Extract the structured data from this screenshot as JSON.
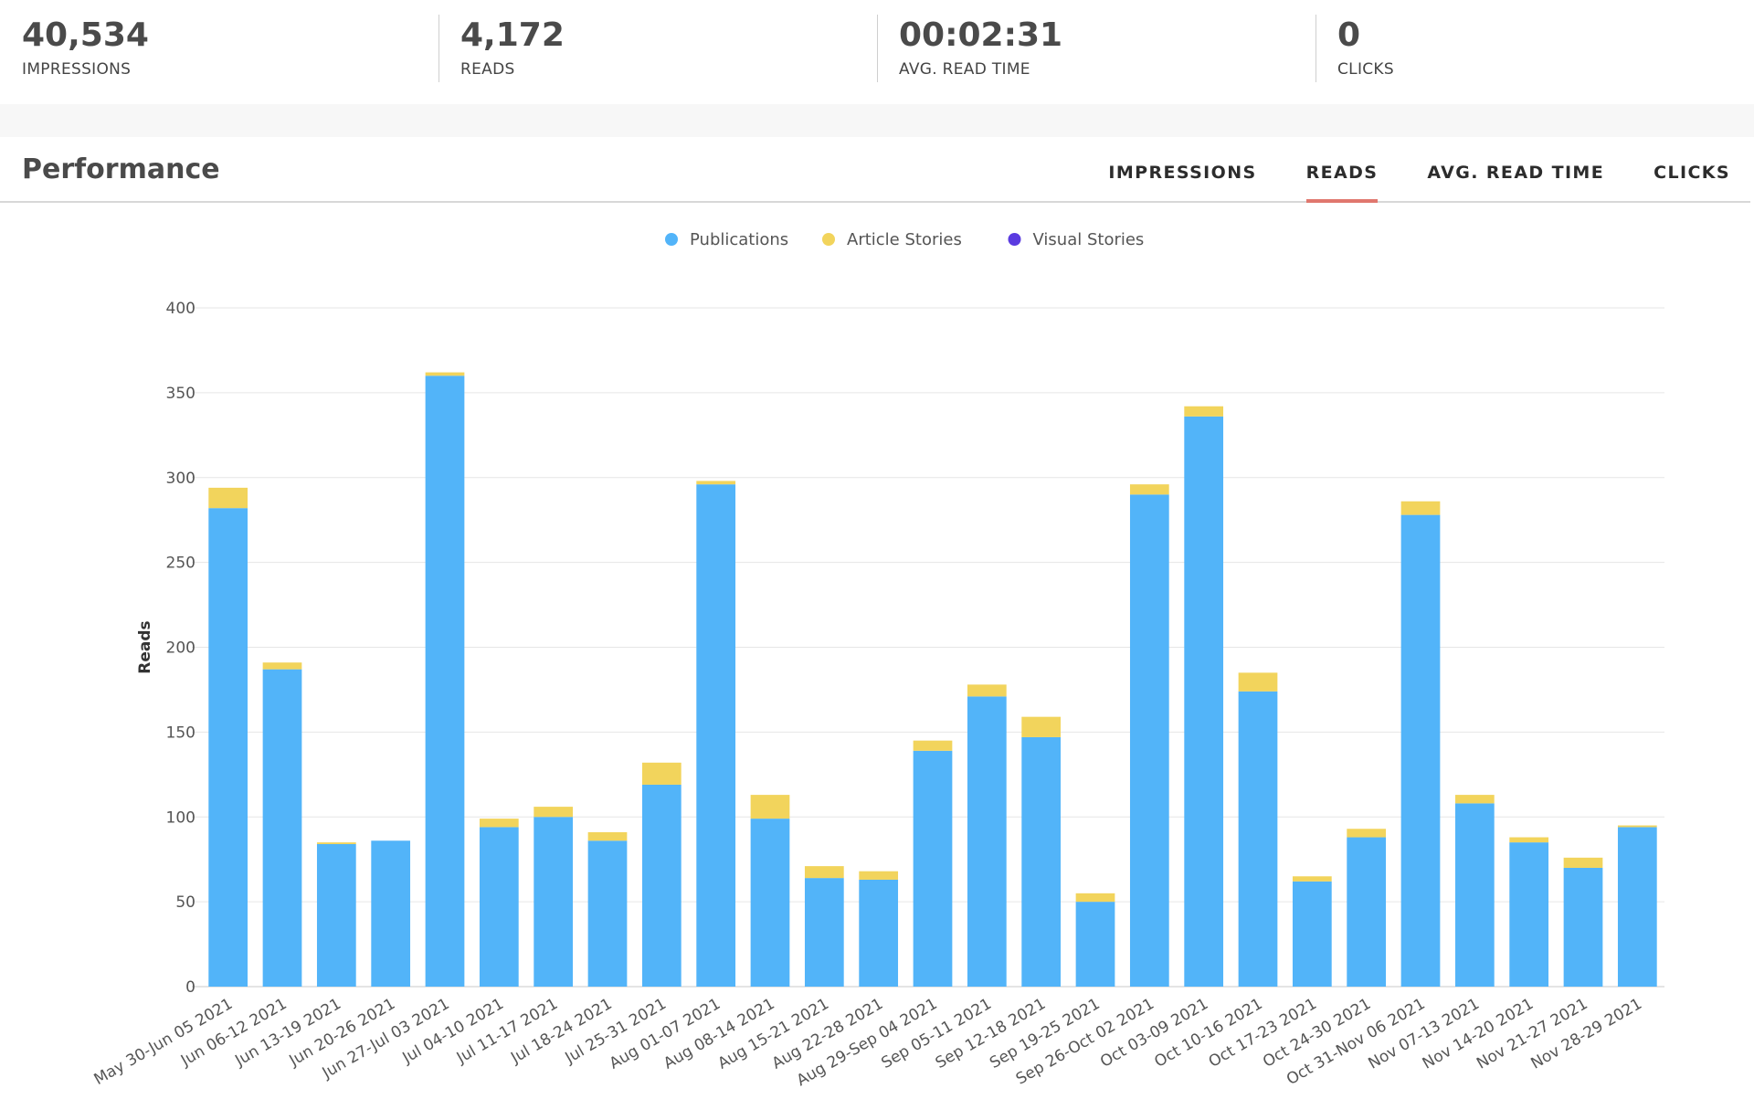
{
  "stats": [
    {
      "value": "40,534",
      "label": "IMPRESSIONS"
    },
    {
      "value": "4,172",
      "label": "READS"
    },
    {
      "value": "00:02:31",
      "label": "AVG. READ TIME"
    },
    {
      "value": "0",
      "label": "CLICKS"
    }
  ],
  "performance": {
    "title": "Performance",
    "tabs": [
      "IMPRESSIONS",
      "READS",
      "AVG. READ TIME",
      "CLICKS"
    ],
    "active_tab": "READS"
  },
  "chart_data": {
    "type": "bar",
    "stacked": true,
    "ylabel": "Reads",
    "ylim": [
      0,
      400
    ],
    "yticks": [
      0,
      50,
      100,
      150,
      200,
      250,
      300,
      350,
      400
    ],
    "legend_position": "top-center",
    "grid": true,
    "categories": [
      "May 30-Jun 05 2021",
      "Jun 06-12 2021",
      "Jun 13-19 2021",
      "Jun 20-26 2021",
      "Jun 27-Jul 03 2021",
      "Jul 04-10 2021",
      "Jul 11-17 2021",
      "Jul 18-24 2021",
      "Jul 25-31 2021",
      "Aug 01-07 2021",
      "Aug 08-14 2021",
      "Aug 15-21 2021",
      "Aug 22-28 2021",
      "Aug 29-Sep 04 2021",
      "Sep 05-11 2021",
      "Sep 12-18 2021",
      "Sep 19-25 2021",
      "Sep 26-Oct 02 2021",
      "Oct 03-09 2021",
      "Oct 10-16 2021",
      "Oct 17-23 2021",
      "Oct 24-30 2021",
      "Oct 31-Nov 06 2021",
      "Nov 07-13 2021",
      "Nov 14-20 2021",
      "Nov 21-27 2021",
      "Nov 28-29 2021"
    ],
    "series": [
      {
        "name": "Publications",
        "color": "#52b4f9",
        "values": [
          282,
          187,
          84,
          86,
          360,
          94,
          100,
          86,
          119,
          296,
          99,
          64,
          63,
          139,
          171,
          147,
          50,
          290,
          336,
          174,
          62,
          88,
          278,
          108,
          85,
          70,
          94
        ]
      },
      {
        "name": "Article Stories",
        "color": "#f2d45c",
        "values": [
          12,
          4,
          1,
          0,
          2,
          5,
          6,
          5,
          13,
          2,
          14,
          7,
          5,
          6,
          7,
          12,
          5,
          6,
          6,
          11,
          3,
          5,
          8,
          5,
          3,
          6,
          1
        ]
      },
      {
        "name": "Visual Stories",
        "color": "#5a3be0",
        "values": [
          0,
          0,
          0,
          0,
          0,
          0,
          0,
          0,
          0,
          0,
          0,
          0,
          0,
          0,
          0,
          0,
          0,
          0,
          0,
          0,
          0,
          0,
          0,
          0,
          0,
          0,
          0
        ]
      }
    ]
  }
}
